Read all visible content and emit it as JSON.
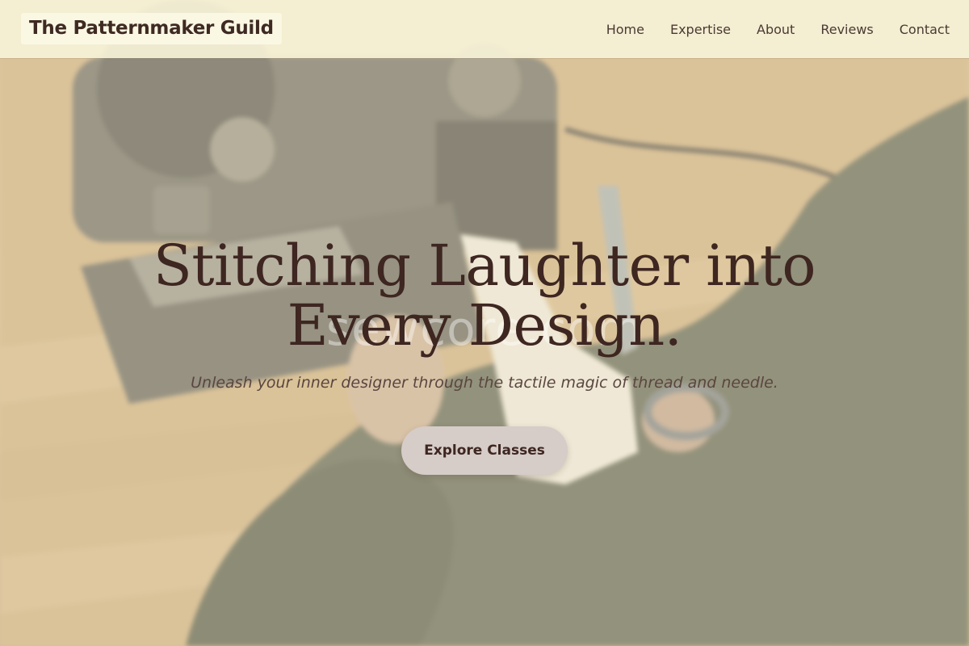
{
  "header": {
    "logo_text": "The Patternmaker Guild",
    "nav": [
      {
        "label": "Home"
      },
      {
        "label": "Expertise"
      },
      {
        "label": "About"
      },
      {
        "label": "Reviews"
      },
      {
        "label": "Contact"
      }
    ]
  },
  "hero": {
    "title": "Stitching Laughter into Every Design.",
    "subtitle": "Unleash your inner designer through the tactile magic of thread and needle.",
    "cta_label": "Explore Classes",
    "watermark_text": "sewcore.com"
  },
  "colors": {
    "text_dark": "#3e2621",
    "header_bg": "#f5f1d6",
    "button_bg": "#d6ccc8",
    "overlay": "#f3eccd"
  }
}
